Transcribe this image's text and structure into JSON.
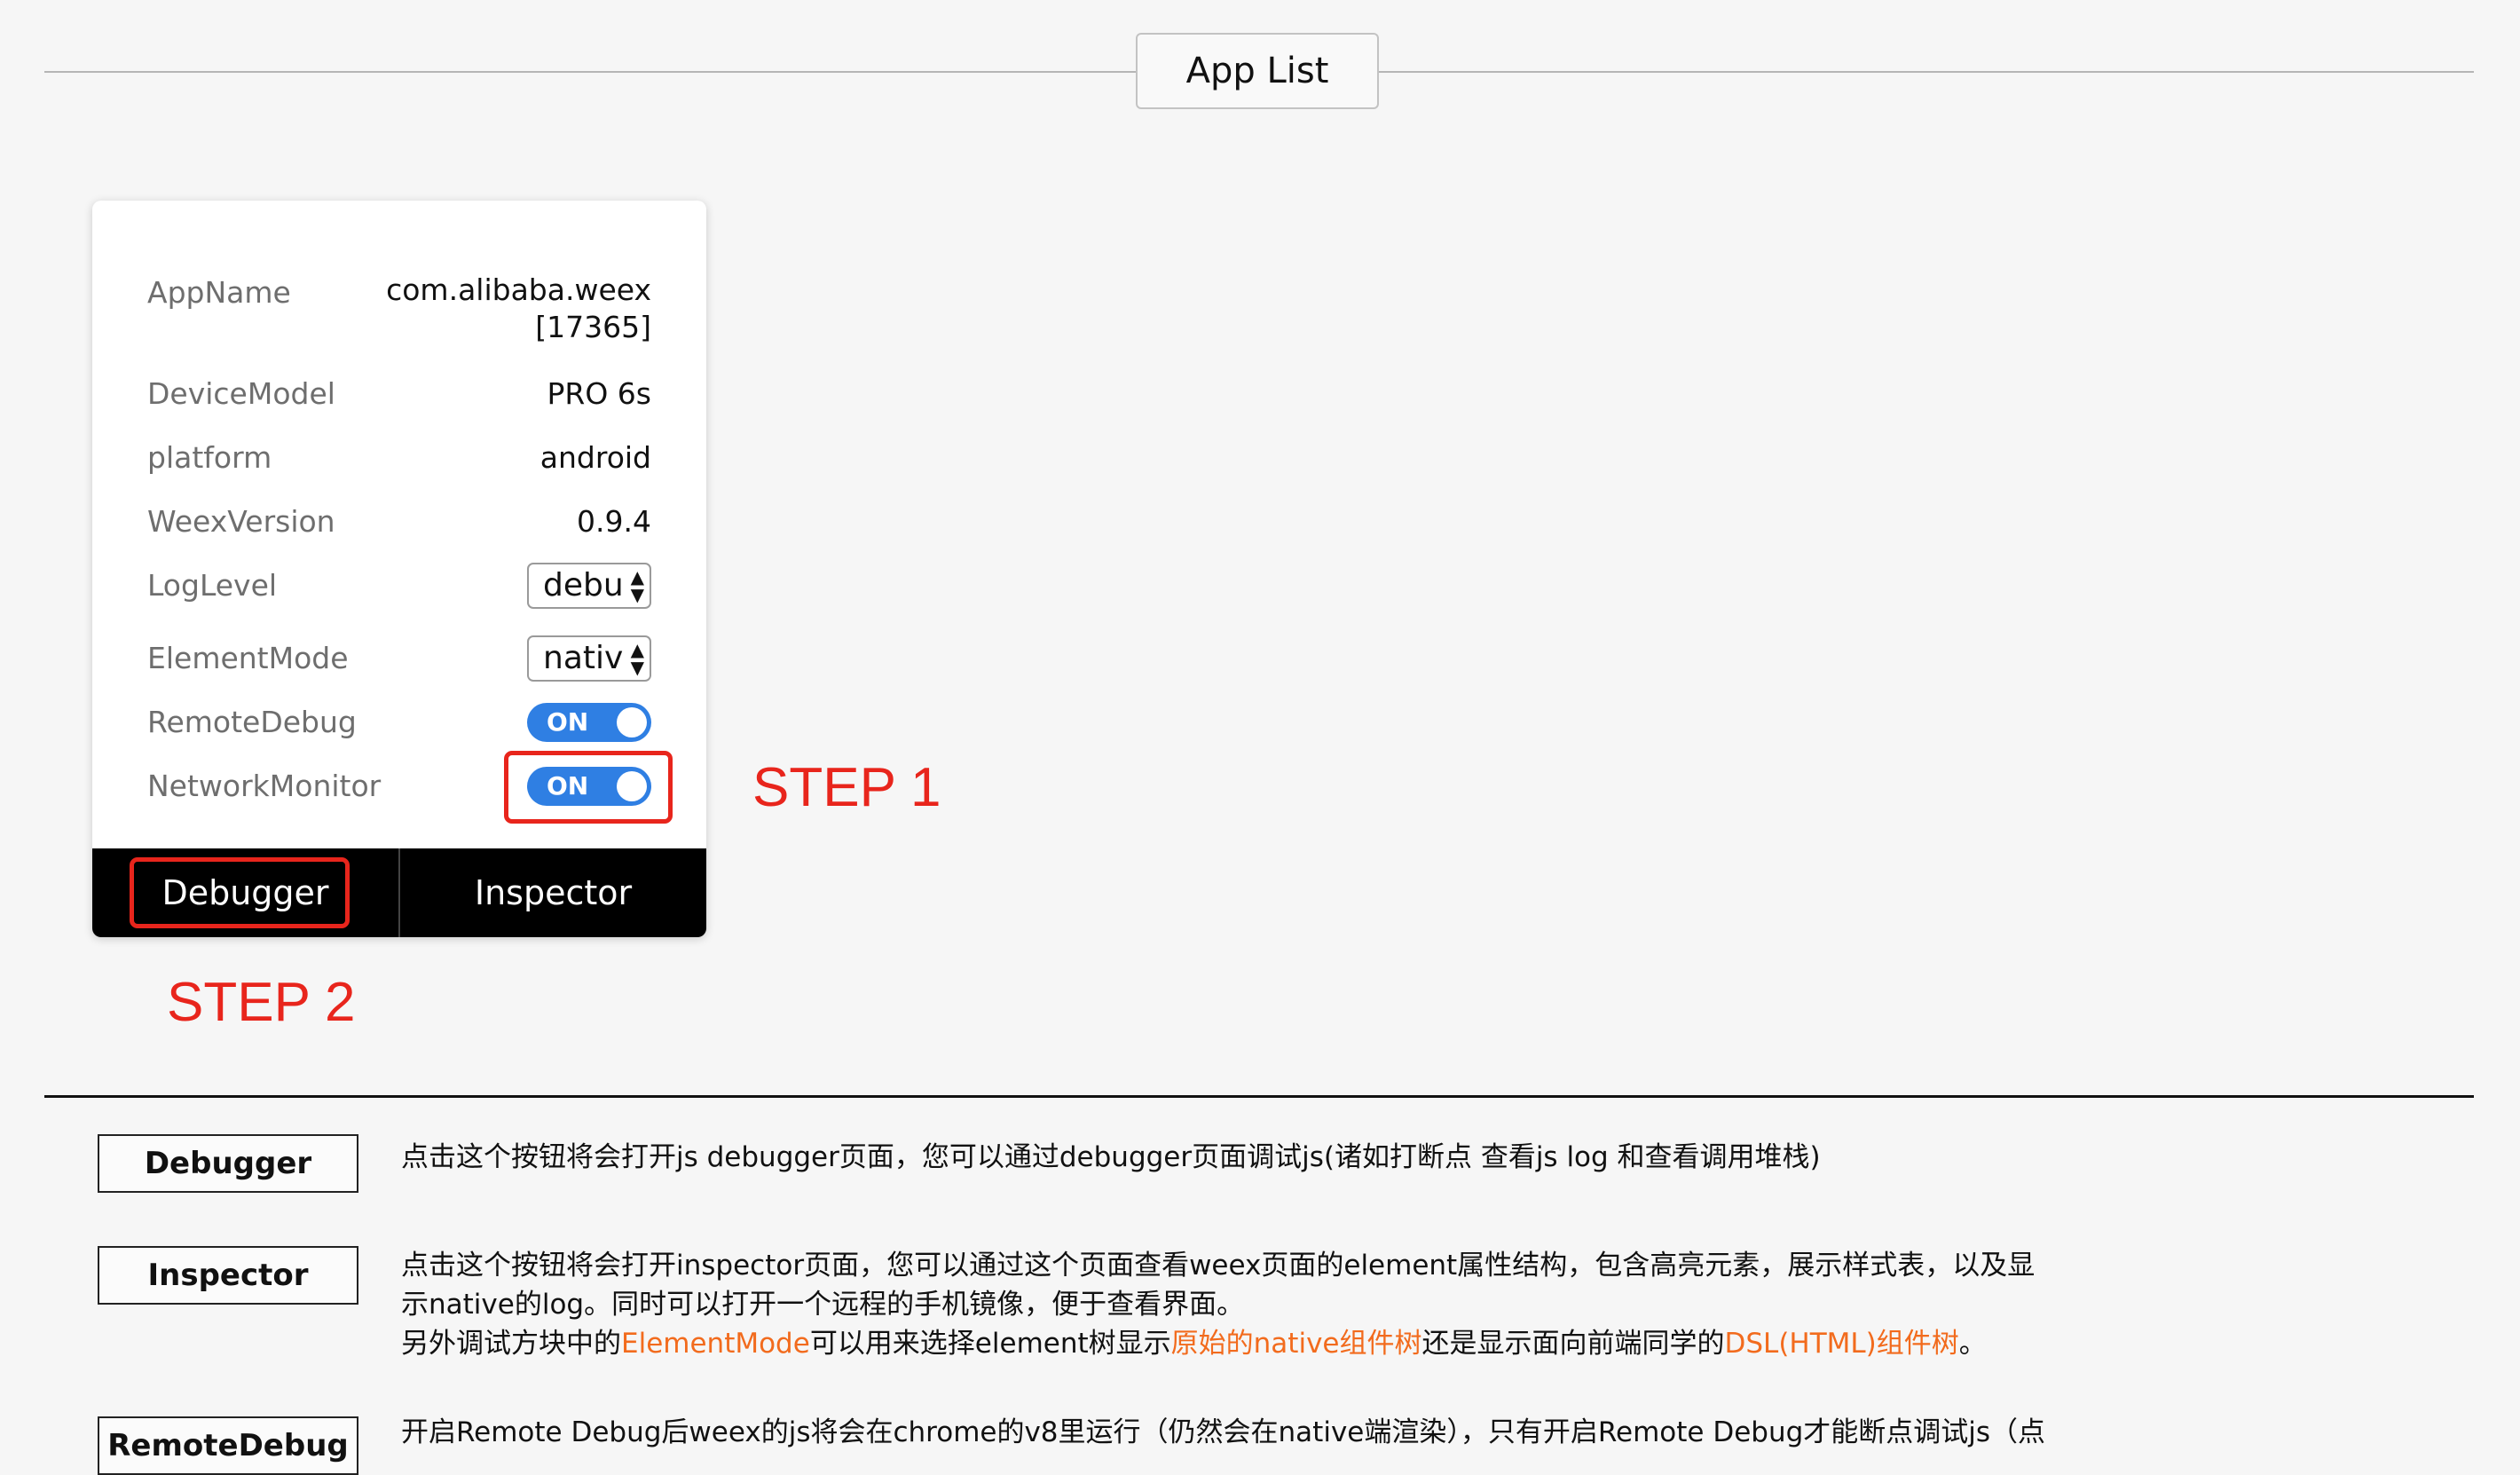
{
  "header": {
    "title": "App List"
  },
  "card": {
    "rows": [
      {
        "label": "AppName",
        "value_line1": "com.alibaba.weex",
        "value_line2": "[17365]"
      },
      {
        "label": "DeviceModel",
        "value": "PRO 6s"
      },
      {
        "label": "platform",
        "value": "android"
      },
      {
        "label": "WeexVersion",
        "value": "0.9.4"
      },
      {
        "label": "LogLevel",
        "selected": "debug"
      },
      {
        "label": "ElementMode",
        "selected": "native"
      },
      {
        "label": "RemoteDebug",
        "toggle": "ON"
      },
      {
        "label": "NetworkMonitor",
        "toggle": "ON"
      }
    ],
    "debugger_label": "Debugger",
    "inspector_label": "Inspector"
  },
  "annotations": {
    "step1": "STEP 1",
    "step2": "STEP 2"
  },
  "docs": {
    "debugger": {
      "button": "Debugger",
      "text": "点击这个按钮将会打开js debugger页面，您可以通过debugger页面调试js(诸如打断点 查看js log 和查看调用堆栈)"
    },
    "inspector": {
      "button": "Inspector",
      "line1": "点击这个按钮将会打开inspector页面，您可以通过这个页面查看weex页面的element属性结构，包含高亮元素，展示样式表，以及显",
      "line2": "示native的log。同时可以打开一个远程的手机镜像，便于查看界面。",
      "line3_a": "另外调试方块中的",
      "line3_b": "ElementMode",
      "line3_c": "可以用来选择element树显示",
      "line3_d": "原始的native组件树",
      "line3_e": "还是显示面向前端同学的",
      "line3_f": "DSL(HTML)组件树",
      "line3_g": "。"
    },
    "remote_debug": {
      "button": "RemoteDebug",
      "text": "开启Remote Debug后weex的js将会在chrome的v8里运行（仍然会在native端渲染），只有开启Remote Debug才能断点调试js（点"
    }
  },
  "colors": {
    "accent": "#2f7fe3",
    "annotation": "#e8251c",
    "highlight": "#f26b1d"
  }
}
